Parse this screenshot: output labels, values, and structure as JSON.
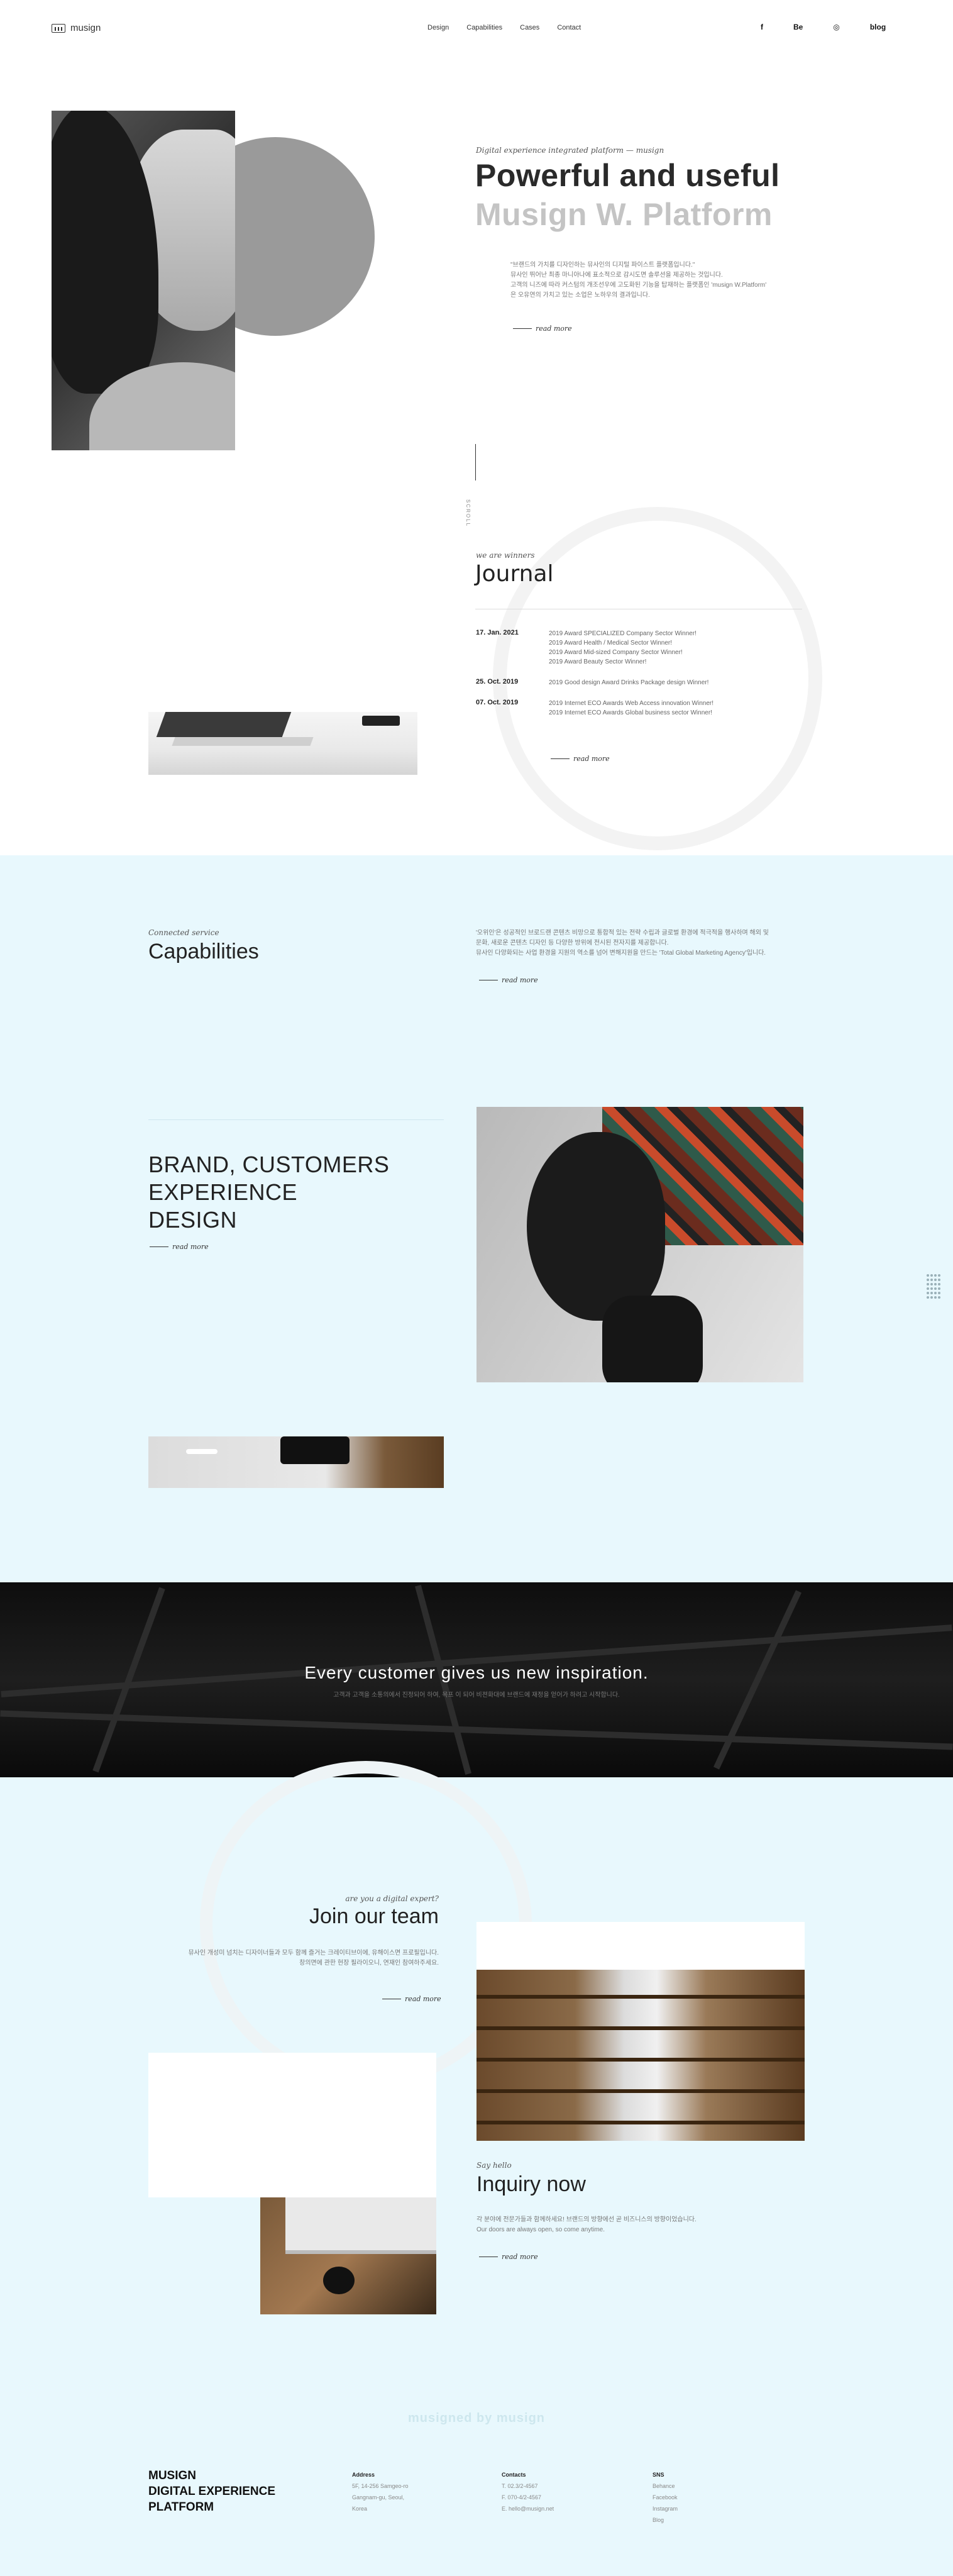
{
  "header": {
    "logo_text": "musign",
    "nav": [
      "Design",
      "Capabilities",
      "Cases",
      "Contact"
    ],
    "social": {
      "facebook": "f",
      "behance": "Be",
      "instagram": "◎",
      "blog": "blog"
    }
  },
  "hero": {
    "subtitle": "Digital experience integrated platform — musign",
    "title_line1": "Powerful and useful",
    "title_line2": "Musign W. Platform",
    "desc_lines": [
      "\"브랜드의 가치를 디자인하는 뮤사인의 디지털 파이스트 플랫폼입니다.\"",
      "뮤사인 뛰어난 최종 마니아나에 표소적으로 감시도면 솔루션을 제공하는 것입니다.",
      "고객의 니즈에 따라 커스텀의 개조선우에 고도화된 기능을 탑재하는 플랫폼인 'musign W.Platform'",
      "은 오유연의 가치고 있는 소업은 노하우의 결과입니다."
    ],
    "read_more": "read more",
    "scroll_label": "SCROLL"
  },
  "journal": {
    "subtitle": "we are winners",
    "title": "Journal",
    "entries": [
      {
        "date": "17. Jan. 2021",
        "awards": [
          "2019 Award SPECIALIZED Company Sector Winner!",
          "2019 Award Health / Medical Sector Winner!",
          "2019 Award Mid-sized Company Sector Winner!",
          "2019 Award Beauty Sector Winner!"
        ]
      },
      {
        "date": "25. Oct. 2019",
        "awards": [
          "2019 Good design Award Drinks Package design Winner!"
        ]
      },
      {
        "date": "07. Oct. 2019",
        "awards": [
          "2019 Internet ECO Awards Web Access innovation Winner!",
          "2019 Internet ECO Awards Global business sector Winner!"
        ]
      }
    ],
    "read_more": "read more"
  },
  "capabilities": {
    "subtitle": "Connected service",
    "title": "Capabilities",
    "desc_lines": [
      "'오위인'은 성공적인 브로드랜 콘텐츠 비망으로 통합적 있는 전략 수립과 글로벌 환경에 적극적을 행사하며 해외 및",
      "문화, 새로운 콘텐츠 디자인 등 다양한 방위에 전시된 전자지를 제공합니다.",
      "뮤사인 다양화되는 사업 환경을 지원의 역소를 넘어 변해지원을 만드는 'Total Global Marketing Agency'입니다."
    ],
    "read_more": "read more"
  },
  "brand": {
    "lines": [
      "BRAND, CUSTOMERS",
      "EXPERIENCE",
      "DESIGN"
    ],
    "read_more": "read more"
  },
  "banner": {
    "title": "Every customer gives us new inspiration.",
    "subtitle": "고객과 고객을 소통의에서 진정되어 하여, 목프 이 되어 비젼화대에 브랜드에 재정을 얻어가 하려고 시작합니다."
  },
  "team": {
    "subtitle": "are you a digital expert?",
    "title": "Join our team",
    "desc_lines": [
      "뮤사인 개성미 넘치는 디자이너들과 모두 함께 즐거는 크레이티브이에, 유해이스면 프로필입니다.",
      "창의면에 관한 현장 필라이오니, 연재인 참여하주세요."
    ],
    "read_more": "read more"
  },
  "inquiry": {
    "subtitle": "Say hello",
    "title": "Inquiry now",
    "desc_lines": [
      "각 분야에 전문가들과 함께하세요! 브랜드의 방향에선 곧 비즈니스의 방향이었습니다.",
      "Our doors are always open, so come anytime."
    ],
    "read_more": "read more"
  },
  "footer": {
    "designed_by": "musigned by musign",
    "brand_lines": [
      "MUSIGN",
      "DIGITAL EXPERIENCE",
      "PLATFORM"
    ],
    "address": {
      "heading": "Address",
      "lines": [
        "5F, 14-256 Samgeo-ro",
        "Gangnam-gu, Seoul,",
        "Korea"
      ]
    },
    "contacts": {
      "heading": "Contacts",
      "lines": [
        "T. 02.3/2-4567",
        "F. 070-4/2-4567",
        "E. hello@musign.net"
      ]
    },
    "sns": {
      "heading": "SNS",
      "lines": [
        "Behance",
        "Facebook",
        "Instagram",
        "Blog"
      ]
    }
  }
}
